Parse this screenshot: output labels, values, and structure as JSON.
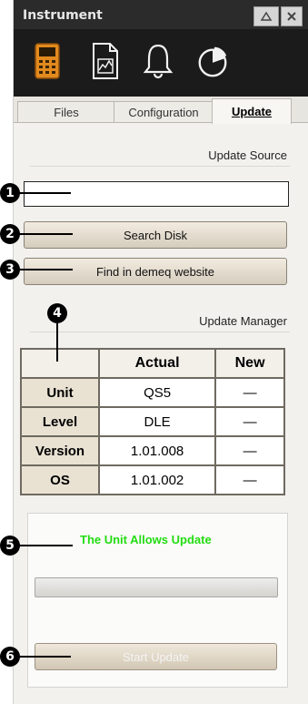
{
  "window": {
    "title": "Instrument"
  },
  "title_buttons": [
    "minimize-icon",
    "close-icon"
  ],
  "toolbar": {
    "icons": [
      "device-icon",
      "file-chart-icon",
      "bell-icon",
      "pie-chart-icon"
    ]
  },
  "tabs": [
    {
      "label": "Files",
      "active": false
    },
    {
      "label": "Configuration",
      "active": false
    },
    {
      "label": "Update",
      "active": true
    }
  ],
  "update_source": {
    "section_label": "Update Source",
    "path_value": "",
    "search_disk_label": "Search Disk",
    "find_web_label": "Find in demeq website"
  },
  "update_manager": {
    "section_label": "Update Manager",
    "columns": [
      "",
      "Actual",
      "New"
    ],
    "rows": [
      {
        "label": "Unit",
        "actual": "QS5",
        "new": "—"
      },
      {
        "label": "Level",
        "actual": "DLE",
        "new": "—"
      },
      {
        "label": "Version",
        "actual": "1.01.008",
        "new": "—"
      },
      {
        "label": "OS",
        "actual": "1.01.002",
        "new": "—"
      }
    ]
  },
  "status": {
    "message": "The Unit Allows Update",
    "message_color": "#22dd11",
    "progress": 0,
    "start_update_label": "Start Update"
  },
  "callouts": [
    "1",
    "2",
    "3",
    "4",
    "5",
    "6"
  ]
}
